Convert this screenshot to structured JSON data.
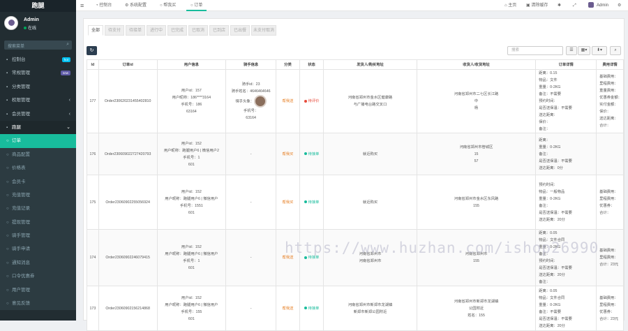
{
  "app": {
    "logo": "跑腿",
    "user_name": "Admin",
    "user_status": "在线",
    "search_placeholder": "搜索菜单"
  },
  "menu": [
    {
      "label": "控制台",
      "icon": "dashboard-icon",
      "badge": "hot",
      "badge_color": "#00c0ef",
      "kind": "item"
    },
    {
      "label": "常规管理",
      "icon": "cog-icon",
      "badge": "new",
      "badge_color": "#605ca8",
      "kind": "item"
    },
    {
      "label": "分类管理",
      "icon": "list-icon",
      "badge": "",
      "badge_color": "",
      "kind": "item"
    },
    {
      "label": "权限管理",
      "icon": "group-icon",
      "badge": "",
      "badge_color": "",
      "kind": "item",
      "chev": "‹"
    },
    {
      "label": "会员管理",
      "icon": "user-icon",
      "badge": "",
      "badge_color": "",
      "kind": "item",
      "chev": "‹"
    },
    {
      "label": "跑腿",
      "icon": "folder-icon",
      "badge": "",
      "badge_color": "",
      "kind": "parent",
      "chev": "⌄"
    },
    {
      "label": "订单",
      "icon": "circle-icon",
      "badge": "",
      "badge_color": "",
      "kind": "active"
    },
    {
      "label": "商品配置",
      "icon": "circle-icon",
      "badge": "",
      "badge_color": "",
      "kind": "sub"
    },
    {
      "label": "价格表",
      "icon": "circle-icon",
      "badge": "",
      "badge_color": "",
      "kind": "sub"
    },
    {
      "label": "会员卡",
      "icon": "circle-icon",
      "badge": "",
      "badge_color": "",
      "kind": "sub"
    },
    {
      "label": "充值管理",
      "icon": "circle-icon",
      "badge": "",
      "badge_color": "",
      "kind": "sub"
    },
    {
      "label": "充值记录",
      "icon": "circle-icon",
      "badge": "",
      "badge_color": "",
      "kind": "sub"
    },
    {
      "label": "提现管理",
      "icon": "circle-icon",
      "badge": "",
      "badge_color": "",
      "kind": "sub"
    },
    {
      "label": "骑手管理",
      "icon": "circle-icon",
      "badge": "",
      "badge_color": "",
      "kind": "sub"
    },
    {
      "label": "骑手申请",
      "icon": "circle-icon",
      "badge": "",
      "badge_color": "",
      "kind": "sub"
    },
    {
      "label": "通知消息",
      "icon": "circle-icon",
      "badge": "",
      "badge_color": "",
      "kind": "sub"
    },
    {
      "label": "口令优惠券",
      "icon": "circle-icon",
      "badge": "",
      "badge_color": "",
      "kind": "sub"
    },
    {
      "label": "用户管理",
      "icon": "circle-icon",
      "badge": "",
      "badge_color": "",
      "kind": "sub"
    },
    {
      "label": "意见反馈",
      "icon": "circle-icon",
      "badge": "",
      "badge_color": "",
      "kind": "sub"
    }
  ],
  "topbar": {
    "hamburger": "≡",
    "tabs": [
      {
        "label": "控制台",
        "icon": "dashboard-icon"
      },
      {
        "label": "系统配置",
        "icon": "cog-icon"
      },
      {
        "label": "帮我买",
        "icon": "cart-icon"
      },
      {
        "label": "订单",
        "icon": "circle-icon"
      }
    ],
    "home": "主页",
    "clear_cache": "清除缓存",
    "admin": "Admin"
  },
  "filter_tabs": [
    "全部",
    "待支付",
    "待接单",
    "进行中",
    "已完成",
    "已取消",
    "已到店",
    "已出餐",
    "未支付取消"
  ],
  "search_placeholder": "搜索",
  "table": {
    "headers": [
      "Id",
      "订单id",
      "用户信息",
      "骑手信息",
      "分类",
      "状态",
      "发货人/购买地址",
      "收货人/收货地址",
      "订单详情",
      "费用详情"
    ],
    "rows": [
      {
        "id": "177",
        "order": "Order23062023145540281​0",
        "user": [
          "用户id：157",
          "用户昵称：186****3164",
          "手机号：186",
          "63164"
        ],
        "rider": [
          "骑手id：23",
          "骑手姓名：4646464646",
          "骑手头像：",
          "手机号：",
          "63164"
        ],
        "category": "帮我送",
        "status": "待评价",
        "status_color": "#e74c3c",
        "sender": [
          "河南省郑州市金水区健康路",
          "与广播电台路交叉口"
        ],
        "receiver": [
          "河南省郑州市二七区长江路",
          "中",
          "杨"
        ],
        "detail": [
          "距离：0.15",
          "物品：文件",
          "重量：0-2KG",
          "备注：不需要",
          "预约时间：",
          "是否送保温：不需要",
          "送达距离：",
          "保价：",
          "备注："
        ],
        "fee": [
          "基础费用：",
          "里程费用：",
          "重量费用：",
          "优惠券金额：",
          "实付金额：",
          "保价：",
          "送达距离：",
          "合计："
        ]
      },
      {
        "id": "176",
        "order": "Order23060902272742079​3",
        "user": [
          "用户id：152",
          "用户昵称：跑腿用户6 | 微信用户2",
          "手机号：1",
          "601"
        ],
        "rider": [
          "-"
        ],
        "category": "帮我买",
        "status": "待接单",
        "status_color": "#18bc9c",
        "sender": [
          "就近购买"
        ],
        "receiver": [
          "河南省郑州市管城区",
          "",
          "15",
          "57"
        ],
        "detail": [
          "距离：",
          "重量：0-2KG",
          "备注：",
          "是否送保温：不需要",
          "送达距离：0分"
        ],
        "fee": [
          "",
          "",
          ""
        ]
      },
      {
        "id": "175",
        "order": "Order23060902255056924",
        "user": [
          "用户id：152",
          "用户昵称：跑腿用户6 | 微信用户",
          "手机号：1551",
          "601"
        ],
        "rider": [
          "-"
        ],
        "category": "帮我买",
        "status": "待接单",
        "status_color": "#18bc9c",
        "sender": [
          "就近购买"
        ],
        "receiver": [
          "河南省郑州市金水区东风路",
          "",
          "155"
        ],
        "detail": [
          "预约时间：",
          "物品：一般物品",
          "重量：0-2KG",
          "备注：",
          "是否送保温：不需要",
          "送达距离：20分"
        ],
        "fee": [
          "基础费用：",
          "里程费用：",
          "优惠券：",
          "合计："
        ]
      },
      {
        "id": "174",
        "order": "Order23060902246079415",
        "user": [
          "用户id：152",
          "用户昵称：跑腿用户6 | 微信用户",
          "手机号：1",
          "601"
        ],
        "rider": [
          "-"
        ],
        "category": "帮我送",
        "status": "待接单",
        "status_color": "#18bc9c",
        "sender": [
          "河南省郑州市",
          "河南省郑州市"
        ],
        "receiver": [
          "河南省郑州市",
          "",
          "155"
        ],
        "detail": [
          "距离：0.05",
          "物品：文件合同",
          "重量：0-2KG",
          "备注：",
          "预约时间：",
          "是否送保温：不需要",
          "送达距离：20分",
          "备注："
        ],
        "fee": [
          "基础费用：",
          "里程费用：",
          "合计：23元"
        ]
      },
      {
        "id": "173",
        "order": "Order23060902156214868",
        "user": [
          "用户id：152",
          "用户昵称：跑腿用户6 | 微信用户",
          "手机号：155",
          "601"
        ],
        "rider": [
          "-"
        ],
        "category": "帮我送",
        "status": "待接单",
        "status_color": "#18bc9c",
        "sender": [
          "河南省郑州市新郑市龙湖镇",
          "新郑市新郑公园附近"
        ],
        "receiver": [
          "河南省郑州市新郑市龙湖镇",
          "公园附近",
          "姓名：155"
        ],
        "detail": [
          "距离：0.05",
          "物品：文件合同",
          "重量：0-2KG",
          "备注：不需要",
          "是否送保温：不需要",
          "送达距离：20分"
        ],
        "fee": [
          "基础费用：",
          "里程费用：",
          "优惠券：",
          "合计：23元"
        ]
      }
    ]
  },
  "watermark": "https://www.huzhan.com/ishop26990"
}
